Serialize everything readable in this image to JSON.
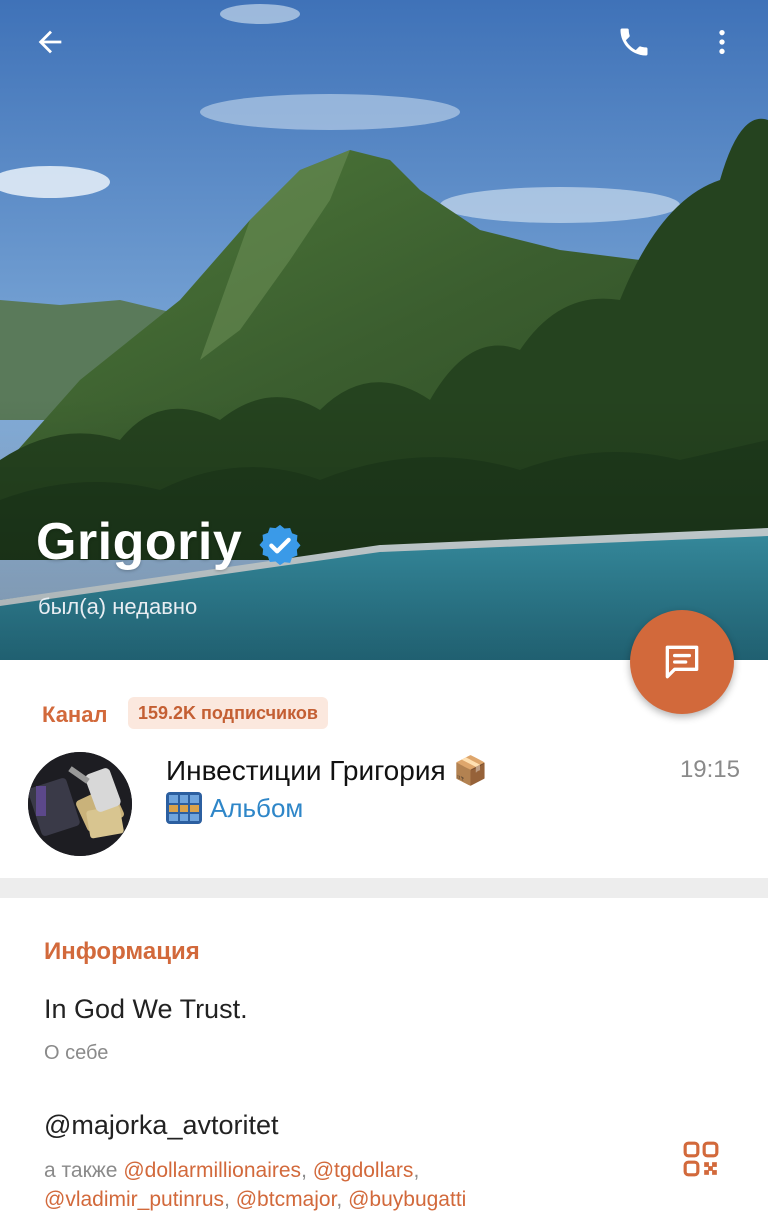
{
  "profile": {
    "name": "Grigoriy",
    "status": "был(а) недавно"
  },
  "channel": {
    "section_label": "Канал",
    "subscribers": "159.2K подписчиков",
    "title": "Инвестиции Григория 📦",
    "last_message": "Альбом",
    "time": "19:15"
  },
  "info": {
    "section_title": "Информация",
    "bio": "In God We Trust.",
    "bio_label": "О себе",
    "username": "@majorka_avtoritet",
    "also_prefix": "а также",
    "also_usernames": [
      "@dollarmillionaires",
      "@tgdollars",
      "@vladimir_putinrus",
      "@btcmajor",
      "@buybugatti"
    ]
  },
  "icons": {
    "back": "arrow-left-icon",
    "call": "phone-icon",
    "more": "more-vertical-icon",
    "verified": "verified-badge-icon",
    "message": "message-icon",
    "album": "album-icon",
    "qr": "qr-code-icon"
  },
  "colors": {
    "accent": "#d2693b",
    "link_blue": "#2e86c8",
    "verified_blue": "#3a9ae8"
  }
}
